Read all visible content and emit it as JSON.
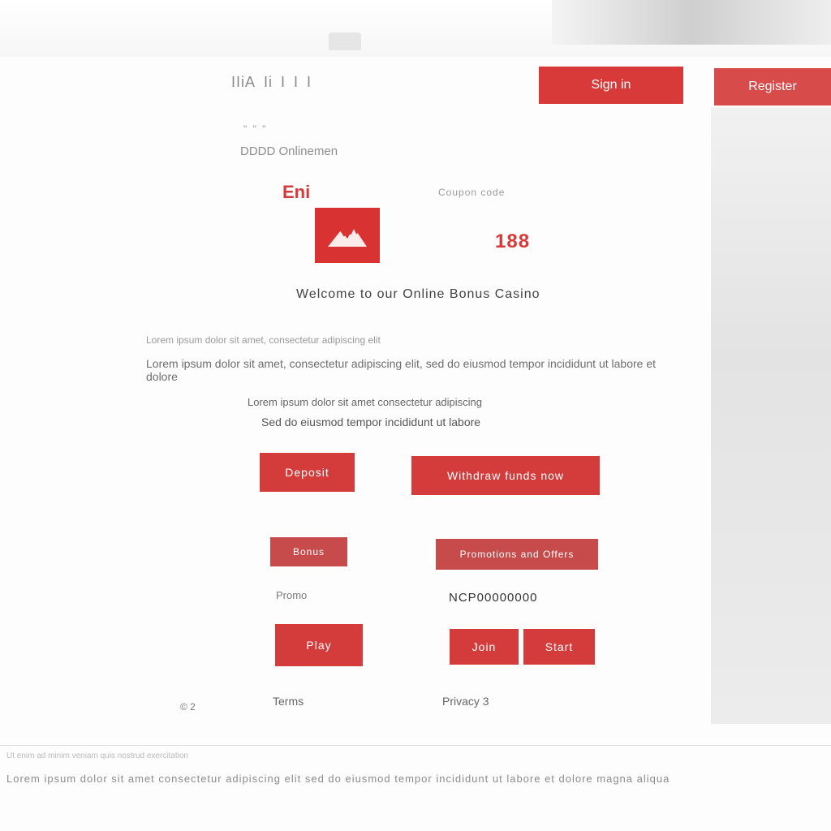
{
  "header": {
    "nav": [
      "IIiA",
      "Ii",
      "I",
      "I",
      "I"
    ],
    "cta_1": "Sign in",
    "cta_2": "Register"
  },
  "subnav": {
    "crumbs": "\" \"  \"",
    "title": "DDDD Onlinemen"
  },
  "card": {
    "brand": "Eni",
    "promo": "Coupon code",
    "badge": "188",
    "heading": "Welcome to our Online Bonus Casino",
    "paragraph_1": "Lorem ipsum dolor sit amet, consectetur adipiscing elit",
    "paragraph_2": "Lorem ipsum dolor sit amet, consectetur adipiscing elit, sed do eiusmod tempor incididunt ut labore et dolore",
    "paragraph_3": "Lorem ipsum dolor sit amet consectetur adipiscing",
    "paragraph_4": "Sed do eiusmod tempor incididunt ut labore"
  },
  "actions": {
    "primary": "Deposit",
    "secondary": "Withdraw funds now",
    "tertiary": "Bonus",
    "quaternary": "Promotions and Offers",
    "promo_label": "Promo",
    "promo_code": "NCP00000000",
    "left_button": "Play",
    "right_button_a": "Join",
    "right_button_b": "Start",
    "left_note": "© 2",
    "mid_note": "Terms",
    "right_note": "Privacy 3"
  },
  "footer": {
    "text": "Lorem ipsum dolor sit amet consectetur adipiscing elit sed do eiusmod tempor incididunt ut labore et dolore magna aliqua",
    "subtext": "Ut enim ad minim veniam quis nostrud exercitation"
  }
}
